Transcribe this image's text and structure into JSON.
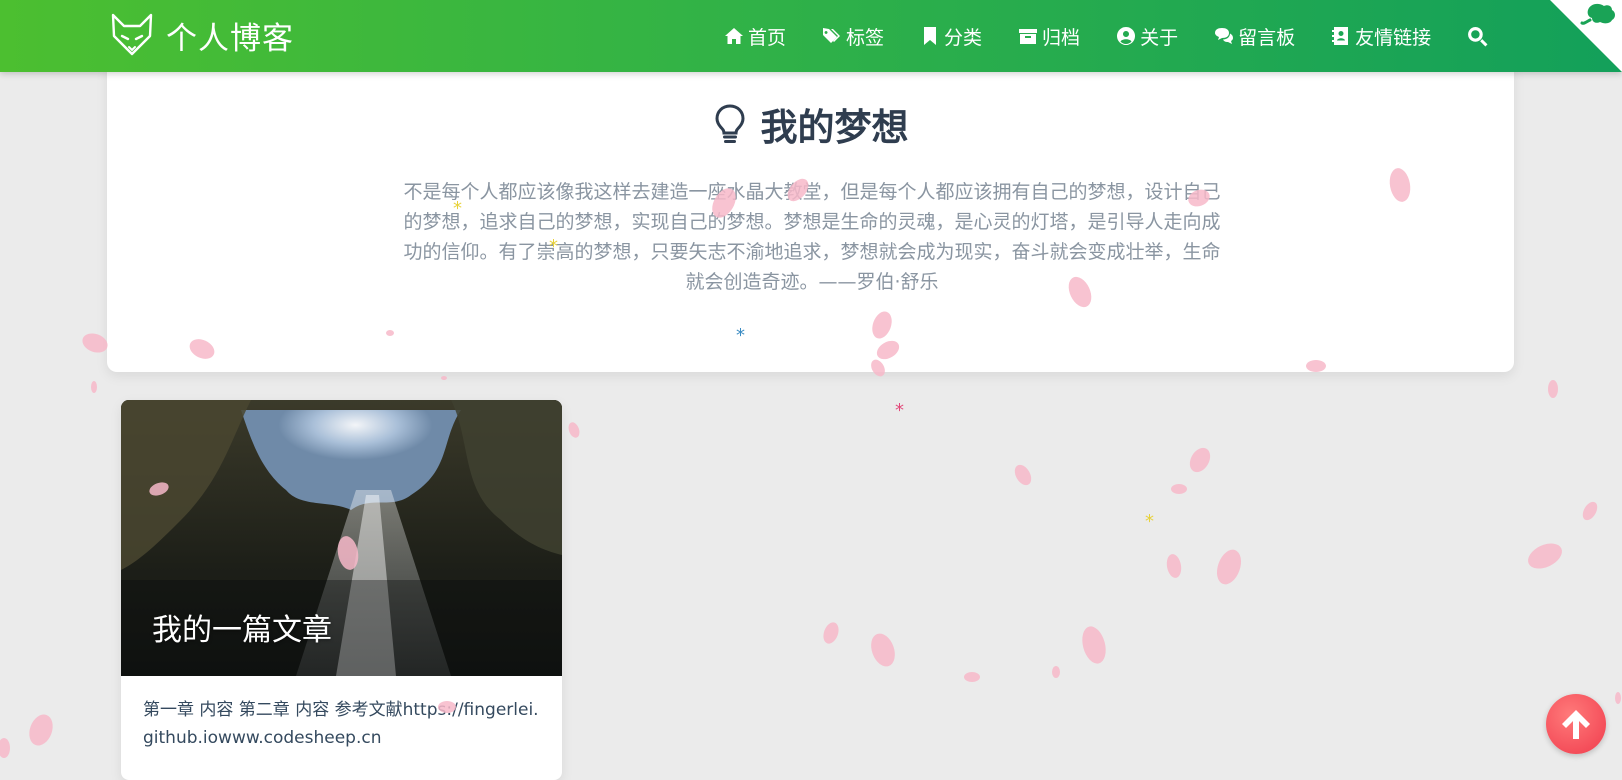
{
  "brand": {
    "title": "个人博客",
    "logo_icon": "fox-icon"
  },
  "nav": {
    "items": [
      {
        "label": "首页",
        "icon": "home-icon"
      },
      {
        "label": "标签",
        "icon": "tags-icon"
      },
      {
        "label": "分类",
        "icon": "bookmark-icon"
      },
      {
        "label": "归档",
        "icon": "archive-icon"
      },
      {
        "label": "关于",
        "icon": "user-circle-icon"
      },
      {
        "label": "留言板",
        "icon": "comments-icon"
      },
      {
        "label": "友情链接",
        "icon": "address-book-icon"
      }
    ],
    "search_icon": "search-icon"
  },
  "dream": {
    "title": "我的梦想",
    "icon": "lightbulb-icon",
    "text": "不是每个人都应该像我这样去建造一座水晶大教堂，但是每个人都应该拥有自己的梦想，设计自己的梦想，追求自己的梦想，实现自己的梦想。梦想是生命的灵魂，是心灵的灯塔，是引导人走向成功的信仰。有了崇高的梦想，只要矢志不渝地追求，梦想就会成为现实，奋斗就会变成壮举，生命就会创造奇迹。——罗伯·舒乐"
  },
  "articles": [
    {
      "title": "我的一篇文章",
      "excerpt": "第一章 内容 第二章 内容 参考文献https://fingerlei.github.iowww.codesheep.cn"
    }
  ],
  "back_to_top_icon": "arrow-up-icon",
  "colors": {
    "header_start": "#4cbf30",
    "header_end": "#13a05a",
    "back_to_top": "#f03c4d",
    "petal": "#f7b9c9"
  }
}
